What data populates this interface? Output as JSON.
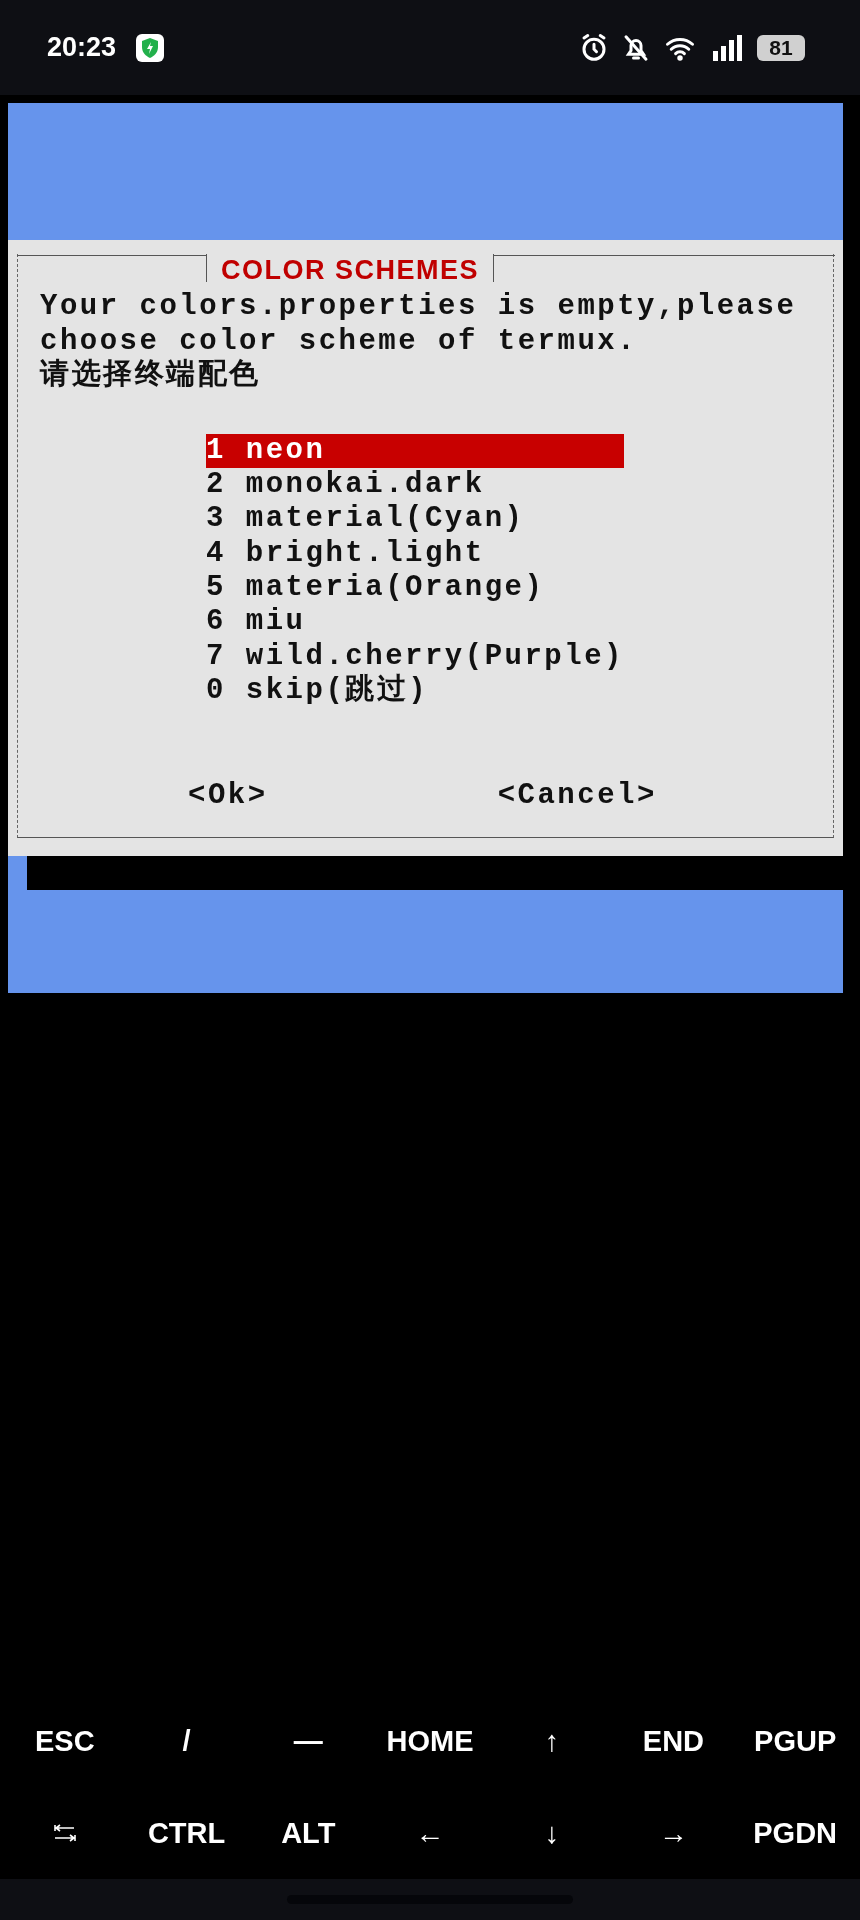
{
  "status_bar": {
    "time": "20:23",
    "battery": "81"
  },
  "dialog": {
    "title": "COLOR SCHEMES",
    "message": [
      "Your colors.properties is empty,please",
      "choose color scheme of termux.",
      "请选择终端配色"
    ],
    "items": [
      {
        "number": "1",
        "label": "neon",
        "selected": true
      },
      {
        "number": "2",
        "label": "monokai.dark",
        "selected": false
      },
      {
        "number": "3",
        "label": "material(Cyan)",
        "selected": false
      },
      {
        "number": "4",
        "label": "bright.light",
        "selected": false
      },
      {
        "number": "5",
        "label": "materia(Orange)",
        "selected": false
      },
      {
        "number": "6",
        "label": "miu",
        "selected": false
      },
      {
        "number": "7",
        "label": "wild.cherry(Purple)",
        "selected": false
      },
      {
        "number": "0",
        "label": "skip(跳过)",
        "selected": false
      }
    ],
    "buttons": [
      "<Ok>",
      "<Cancel>"
    ]
  },
  "extra_keys": [
    [
      {
        "kind": "text",
        "label": "ESC"
      },
      {
        "kind": "text",
        "label": "/"
      },
      {
        "kind": "text",
        "label": "—"
      },
      {
        "kind": "text",
        "label": "HOME"
      },
      {
        "kind": "text",
        "label": "↑"
      },
      {
        "kind": "text",
        "label": "END"
      },
      {
        "kind": "text",
        "label": "PGUP"
      }
    ],
    [
      {
        "kind": "tab"
      },
      {
        "kind": "text",
        "label": "CTRL"
      },
      {
        "kind": "text",
        "label": "ALT"
      },
      {
        "kind": "text",
        "label": "←"
      },
      {
        "kind": "text",
        "label": "↓"
      },
      {
        "kind": "text",
        "label": "→"
      },
      {
        "kind": "text",
        "label": "PGDN"
      }
    ]
  ]
}
